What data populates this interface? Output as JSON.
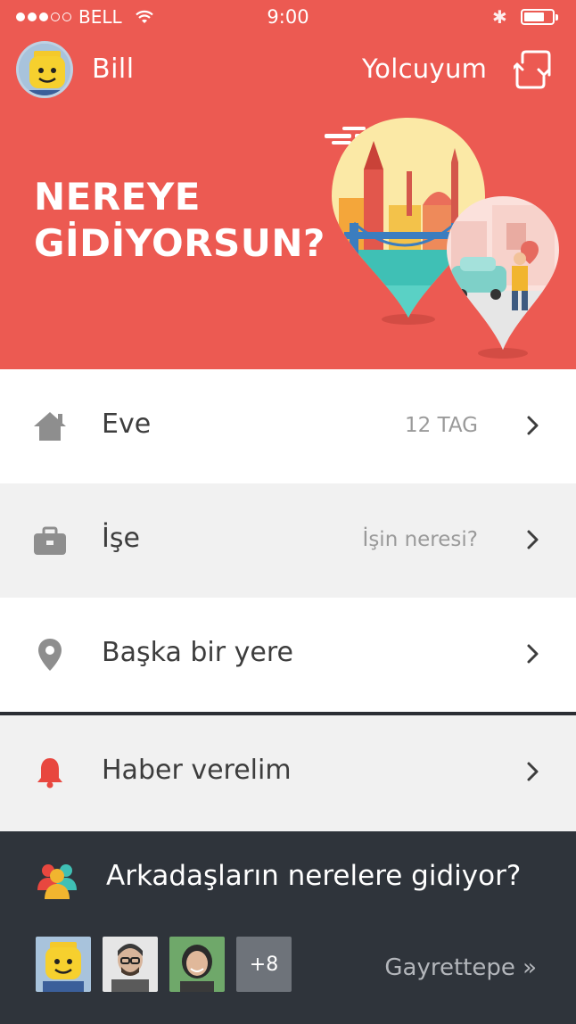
{
  "status_bar": {
    "carrier": "BELL",
    "time": "9:00",
    "signal_bars": 3,
    "signal_total": 5
  },
  "header": {
    "username": "Bill",
    "mode_label": "Yolcuyum",
    "headline_line1": "NEREYE",
    "headline_line2": "GİDİYORSUN?"
  },
  "destinations": [
    {
      "label": "Eve",
      "meta": "12 TAG",
      "icon": "home-icon"
    },
    {
      "label": "İşe",
      "meta": "İşin neresi?",
      "icon": "briefcase-icon"
    },
    {
      "label": "Başka bir yere",
      "meta": "",
      "icon": "location-pin-icon"
    },
    {
      "label": "Haber verelim",
      "meta": "",
      "icon": "bell-icon"
    }
  ],
  "friends": {
    "title": "Arkadaşların nerelere gidiyor?",
    "more_count": "+8",
    "location_link": "Gayrettepe »"
  },
  "colors": {
    "brand": "#ec5a52",
    "dark": "#2f343b",
    "icon_grey": "#8e8e8e",
    "bell_red": "#e8473f"
  }
}
